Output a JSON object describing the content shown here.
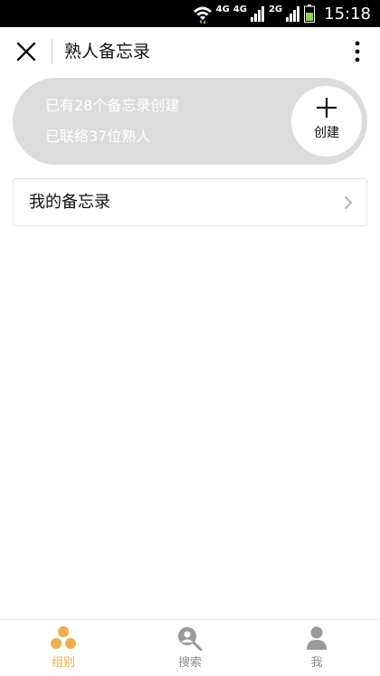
{
  "status_bar": {
    "network_1": "4G",
    "network_2": "4G",
    "network_3": "2G",
    "time": "15:18"
  },
  "header": {
    "title": "熟人备忘录",
    "close_icon": "close-icon",
    "more_icon": "more-vertical-icon"
  },
  "summary": {
    "line1": "已有28个备忘录创建",
    "line2": "已联络37位熟人",
    "create_label": "创建",
    "create_icon": "plus-icon"
  },
  "list": {
    "my_memos_label": "我的备忘录",
    "chevron_icon": "chevron-right-icon"
  },
  "bottom_nav": {
    "items": [
      {
        "label": "组别",
        "icon": "group-icon",
        "active": true
      },
      {
        "label": "搜索",
        "icon": "search-person-icon",
        "active": false
      },
      {
        "label": "我",
        "icon": "profile-icon",
        "active": false
      }
    ]
  },
  "colors": {
    "accent": "#f0ad4e",
    "card_bg": "#dcdcdc",
    "inactive": "#8c8c8c"
  }
}
